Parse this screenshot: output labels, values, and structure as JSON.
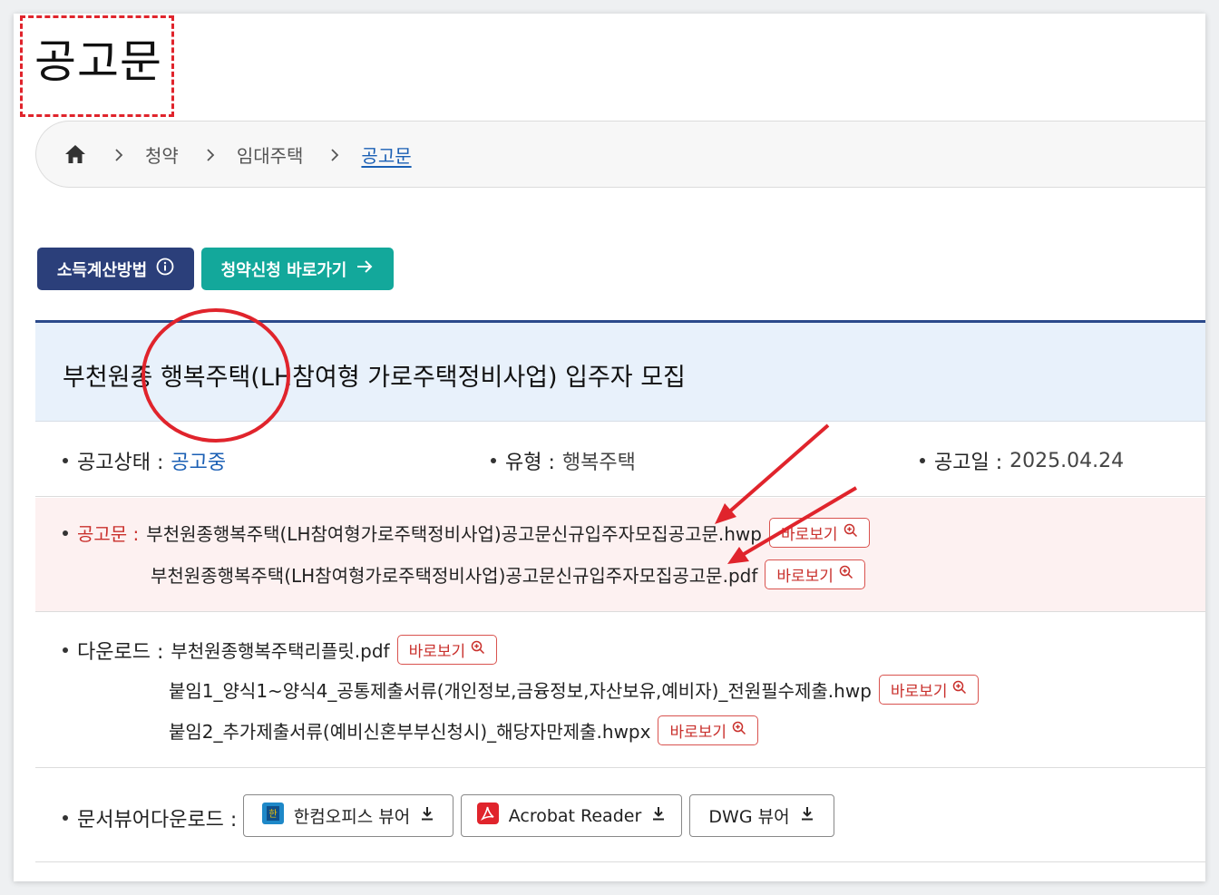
{
  "page": {
    "title": "공고문"
  },
  "breadcrumb": {
    "items": [
      "청약",
      "임대주택"
    ],
    "current": "공고문"
  },
  "buttons": {
    "income": "소득계산방법",
    "apply": "청약신청 바로가기"
  },
  "notice": {
    "title": "부천원종 행복주택(LH참여형 가로주택정비사업) 입주자 모집",
    "status_label": "공고상태 :",
    "status_value": "공고중",
    "type_label": "유형 :",
    "type_value": "행복주택",
    "date_label": "공고일 :",
    "date_value": "2025.04.24"
  },
  "notice_files": {
    "label": "공고문 :",
    "files": [
      "부천원종행복주택(LH참여형가로주택정비사업)공고문신규입주자모집공고문.hwp",
      "부천원종행복주택(LH참여형가로주택정비사업)공고문신규입주자모집공고문.pdf"
    ],
    "view_label": "바로보기"
  },
  "downloads": {
    "label": "다운로드 :",
    "files": [
      "부천원종행복주택리플릿.pdf",
      "붙임1_양식1~양식4_공통제출서류(개인정보,금융정보,자산보유,예비자)_전원필수제출.hwp",
      "붙임2_추가제출서류(예비신혼부부신청시)_해당자만제출.hwpx"
    ],
    "view_label": "바로보기"
  },
  "viewers": {
    "label": "문서뷰어다운로드 :",
    "items": [
      "한컴오피스 뷰어",
      "Acrobat Reader",
      "DWG 뷰어"
    ]
  },
  "colors": {
    "navy": "#2b3f7a",
    "teal": "#13a89b",
    "link_blue": "#1a5fb4",
    "annotation_red": "#e0242c"
  }
}
